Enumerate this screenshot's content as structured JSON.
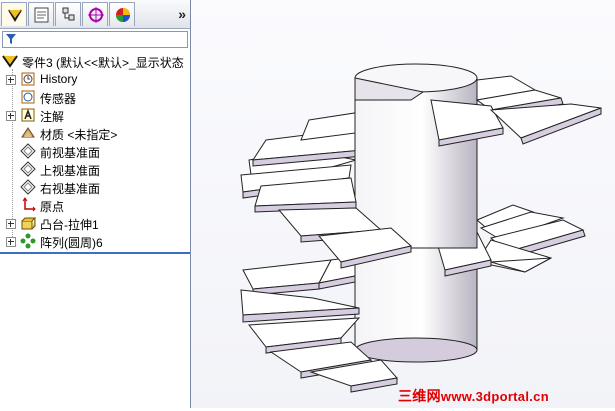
{
  "feature_manager": {
    "tabs": [
      {
        "name": "FeatureManager design tree",
        "icon": "feature-tree-icon"
      },
      {
        "name": "PropertyManager",
        "icon": "property-manager-icon"
      },
      {
        "name": "ConfigurationManager",
        "icon": "configuration-manager-icon"
      },
      {
        "name": "DimXpertManager",
        "icon": "dimxpert-icon"
      },
      {
        "name": "DisplayManager",
        "icon": "display-manager-icon"
      }
    ],
    "more_glyph": "»",
    "tree": {
      "root": "零件3  (默认<<默认>_显示状态",
      "items": [
        {
          "label": "History",
          "icon": "history-icon",
          "expandable": true
        },
        {
          "label": "传感器",
          "icon": "sensor-icon",
          "expandable": false
        },
        {
          "label": "注解",
          "icon": "annotation-icon",
          "expandable": true
        },
        {
          "label": "材质 <未指定>",
          "icon": "material-icon",
          "expandable": false
        },
        {
          "label": "前视基准面",
          "icon": "plane-icon",
          "expandable": false
        },
        {
          "label": "上视基准面",
          "icon": "plane-icon",
          "expandable": false
        },
        {
          "label": "右视基准面",
          "icon": "plane-icon",
          "expandable": false
        },
        {
          "label": "原点",
          "icon": "origin-icon",
          "expandable": false
        },
        {
          "label": "凸台-拉伸1",
          "icon": "extrude-icon",
          "expandable": true
        },
        {
          "label": "阵列(圆周)6",
          "icon": "circular-pattern-icon",
          "expandable": true
        }
      ]
    }
  },
  "watermark": {
    "part1": "三维网",
    "part2": "www.3dportal.cn"
  },
  "colors": {
    "accent": "#3a6fc4",
    "step_top": "#ffffff",
    "step_side": "#d8cfe0",
    "column": "#e8e6ec"
  }
}
